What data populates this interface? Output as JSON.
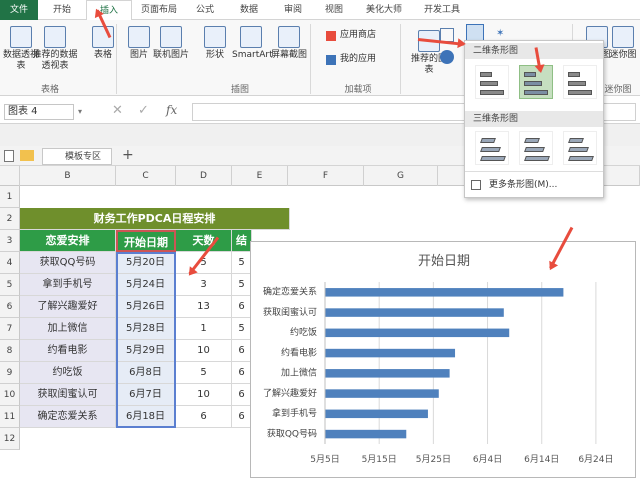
{
  "ribbon_tabs": [
    "文件",
    "开始",
    "插入",
    "页面布局",
    "公式",
    "数据",
    "审阅",
    "视图",
    "美化大师",
    "开发工具"
  ],
  "active_tab": "插入",
  "ribbon": {
    "buttons": [
      "数据透视表",
      "推荐的数据透视表",
      "表格",
      "图片",
      "联机图片",
      "形状",
      "SmartArt",
      "屏幕截图",
      "应用商店",
      "我的应用",
      "推荐的图表",
      "柱形图",
      "迷你图"
    ],
    "groups": [
      "表格",
      "插图",
      "加载项",
      "迷你图"
    ]
  },
  "formula_bar": {
    "name_box": "图表 4",
    "fx": "fx"
  },
  "sheet_tabs": {
    "template_zone": "模板专区",
    "add": "+"
  },
  "columns": [
    "B",
    "C",
    "D",
    "E",
    "F",
    "G",
    "H",
    "I"
  ],
  "rows": [
    "1",
    "2",
    "3",
    "4",
    "5",
    "6",
    "7",
    "8",
    "9",
    "10",
    "11",
    "12"
  ],
  "sheet": {
    "title": "财务工作PDCA日程安排",
    "headers": [
      "恋爱安排",
      "开始日期",
      "天数",
      "结"
    ],
    "rows": [
      [
        "获取QQ号码",
        "5月20日",
        "5",
        "5"
      ],
      [
        "拿到手机号",
        "5月24日",
        "3",
        "5"
      ],
      [
        "了解兴趣爱好",
        "5月26日",
        "13",
        "6"
      ],
      [
        "加上微信",
        "5月28日",
        "1",
        "5"
      ],
      [
        "约看电影",
        "5月29日",
        "10",
        "6"
      ],
      [
        "约吃饭",
        "6月8日",
        "5",
        "6"
      ],
      [
        "获取闺蜜认可",
        "6月7日",
        "10",
        "6"
      ],
      [
        "确定恋爱关系",
        "6月18日",
        "6",
        "6"
      ]
    ]
  },
  "dropdown": {
    "section_2d": "二维条形图",
    "section_3d": "三维条形图",
    "more": "更多条形图(M)..."
  },
  "colors": {
    "excel_green": "#217346",
    "header_green": "#2e9c47",
    "title_green": "#6f8f2c",
    "bar_blue": "#4f81bd",
    "arrow_red": "#e84c3d"
  },
  "chart_data": {
    "type": "bar",
    "orientation": "horizontal",
    "title": "开始日期",
    "categories": [
      "获取QQ号码",
      "拿到手机号",
      "了解兴趣爱好",
      "加上微信",
      "约看电影",
      "约吃饭",
      "获取闺蜜认可",
      "确定恋爱关系"
    ],
    "values": [
      "5月20日",
      "5月24日",
      "5月26日",
      "5月28日",
      "5月29日",
      "6月8日",
      "6月7日",
      "6月18日"
    ],
    "values_day_of_year": [
      140,
      144,
      146,
      148,
      149,
      159,
      158,
      169
    ],
    "xlim_day_of_year": [
      125,
      180
    ],
    "x_tick_labels": [
      "5月5日",
      "5月15日",
      "5月25日",
      "6月4日",
      "6月14日",
      "6月24日"
    ],
    "x_ticks_day_of_year": [
      125,
      135,
      145,
      155,
      165,
      175
    ],
    "grid": true,
    "legend": "none"
  }
}
